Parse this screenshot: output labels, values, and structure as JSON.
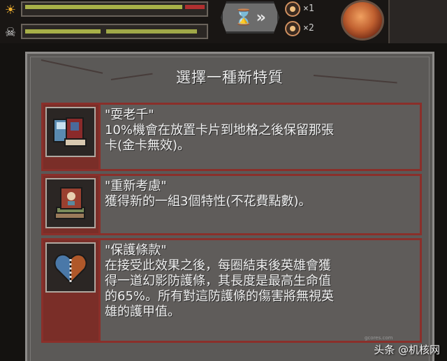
{
  "hud": {
    "speed_options": [
      {
        "label": "×1"
      },
      {
        "label": "×2"
      }
    ],
    "icons": [
      "sun-icon",
      "skull-icon",
      "hourglass-icon",
      "fast-forward-icon",
      "orb-icon"
    ],
    "meters": [
      {
        "name": "day-meter",
        "level": 0.84
      },
      {
        "name": "health-meter",
        "level": 0.42
      }
    ]
  },
  "panel": {
    "title": "選擇一種新特質",
    "traits": [
      {
        "name": "\"耍老千\"",
        "description": "10%機會在放置卡片到地格之後保留那張\n卡(金卡無效)。",
        "icon": "cards-icon"
      },
      {
        "name": "\"重新考慮\"",
        "description": "獲得新的一組3個特性(不花費點數)。",
        "icon": "book-stack-icon"
      },
      {
        "name": "\"保護條款\"",
        "description": "在接受此效果之後，每圈結束後英雄會獲\n得一道幻影防護條，其長度是最高生命值\n的65%。所有對這防護條的傷害將無視英\n雄的護甲值。",
        "icon": "shield-heart-icon"
      }
    ]
  },
  "watermark": {
    "text": "头条 @机核网",
    "sub": "gcores.com"
  },
  "colors": {
    "panel_bg": "#5b5957",
    "card_border": "#8a2f2a",
    "text": "#f0f0f0"
  }
}
